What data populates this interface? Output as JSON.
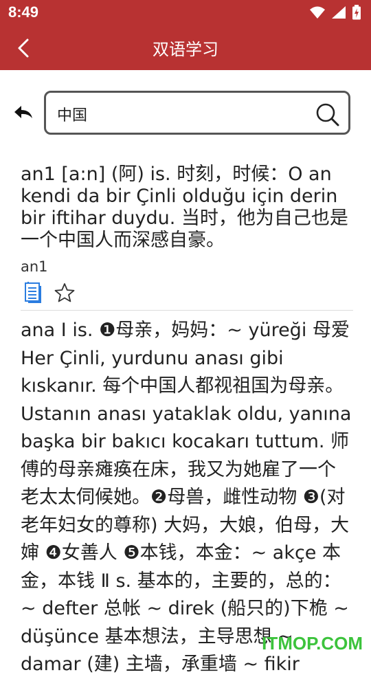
{
  "status_bar": {
    "time": "8:49",
    "icons": [
      "wifi-icon",
      "signal-icon",
      "battery-icon"
    ]
  },
  "app_bar": {
    "title": "双语学习",
    "back_icon": "chevron-left-icon",
    "color": "#b83232"
  },
  "search": {
    "value": "中国",
    "placeholder": ""
  },
  "entries": [
    {
      "text": "an1 [a:n] (阿) is. 时刻，时候：O an kendi da bir Çinli olduğu için derin bir iftihar duydu. 当时，他为自己也是一个中国人而深感自豪。",
      "headword": "an1"
    },
    {
      "text": "ana Ⅰ is. ❶母亲，妈妈：~ yüreği 母爱 Her Çinli, yurdunu anası gibi kıskanır. 每个中国人都视祖国为母亲。Ustanın anası yataklak oldu, yanına başka bir bakıcı kocakarı tuttum. 师傅的母亲瘫痪在床，我又为她雇了一个老太太伺候她。❷母兽，雌性动物 ❸(对老年妇女的尊称) 大妈，大娘，伯母，大婶 ❹女善人 ❺本钱，本金：~ akçe 本金，本钱 Ⅱ s. 基本的，主要的，总的：~ defter 总帐 ~ direk (船只的)下桅 ~ düşünce 基本想法，主导思想 ~ damar (建) 主墙，承重墙 ~ fikir"
    }
  ],
  "watermark": "ITMOP.COM"
}
